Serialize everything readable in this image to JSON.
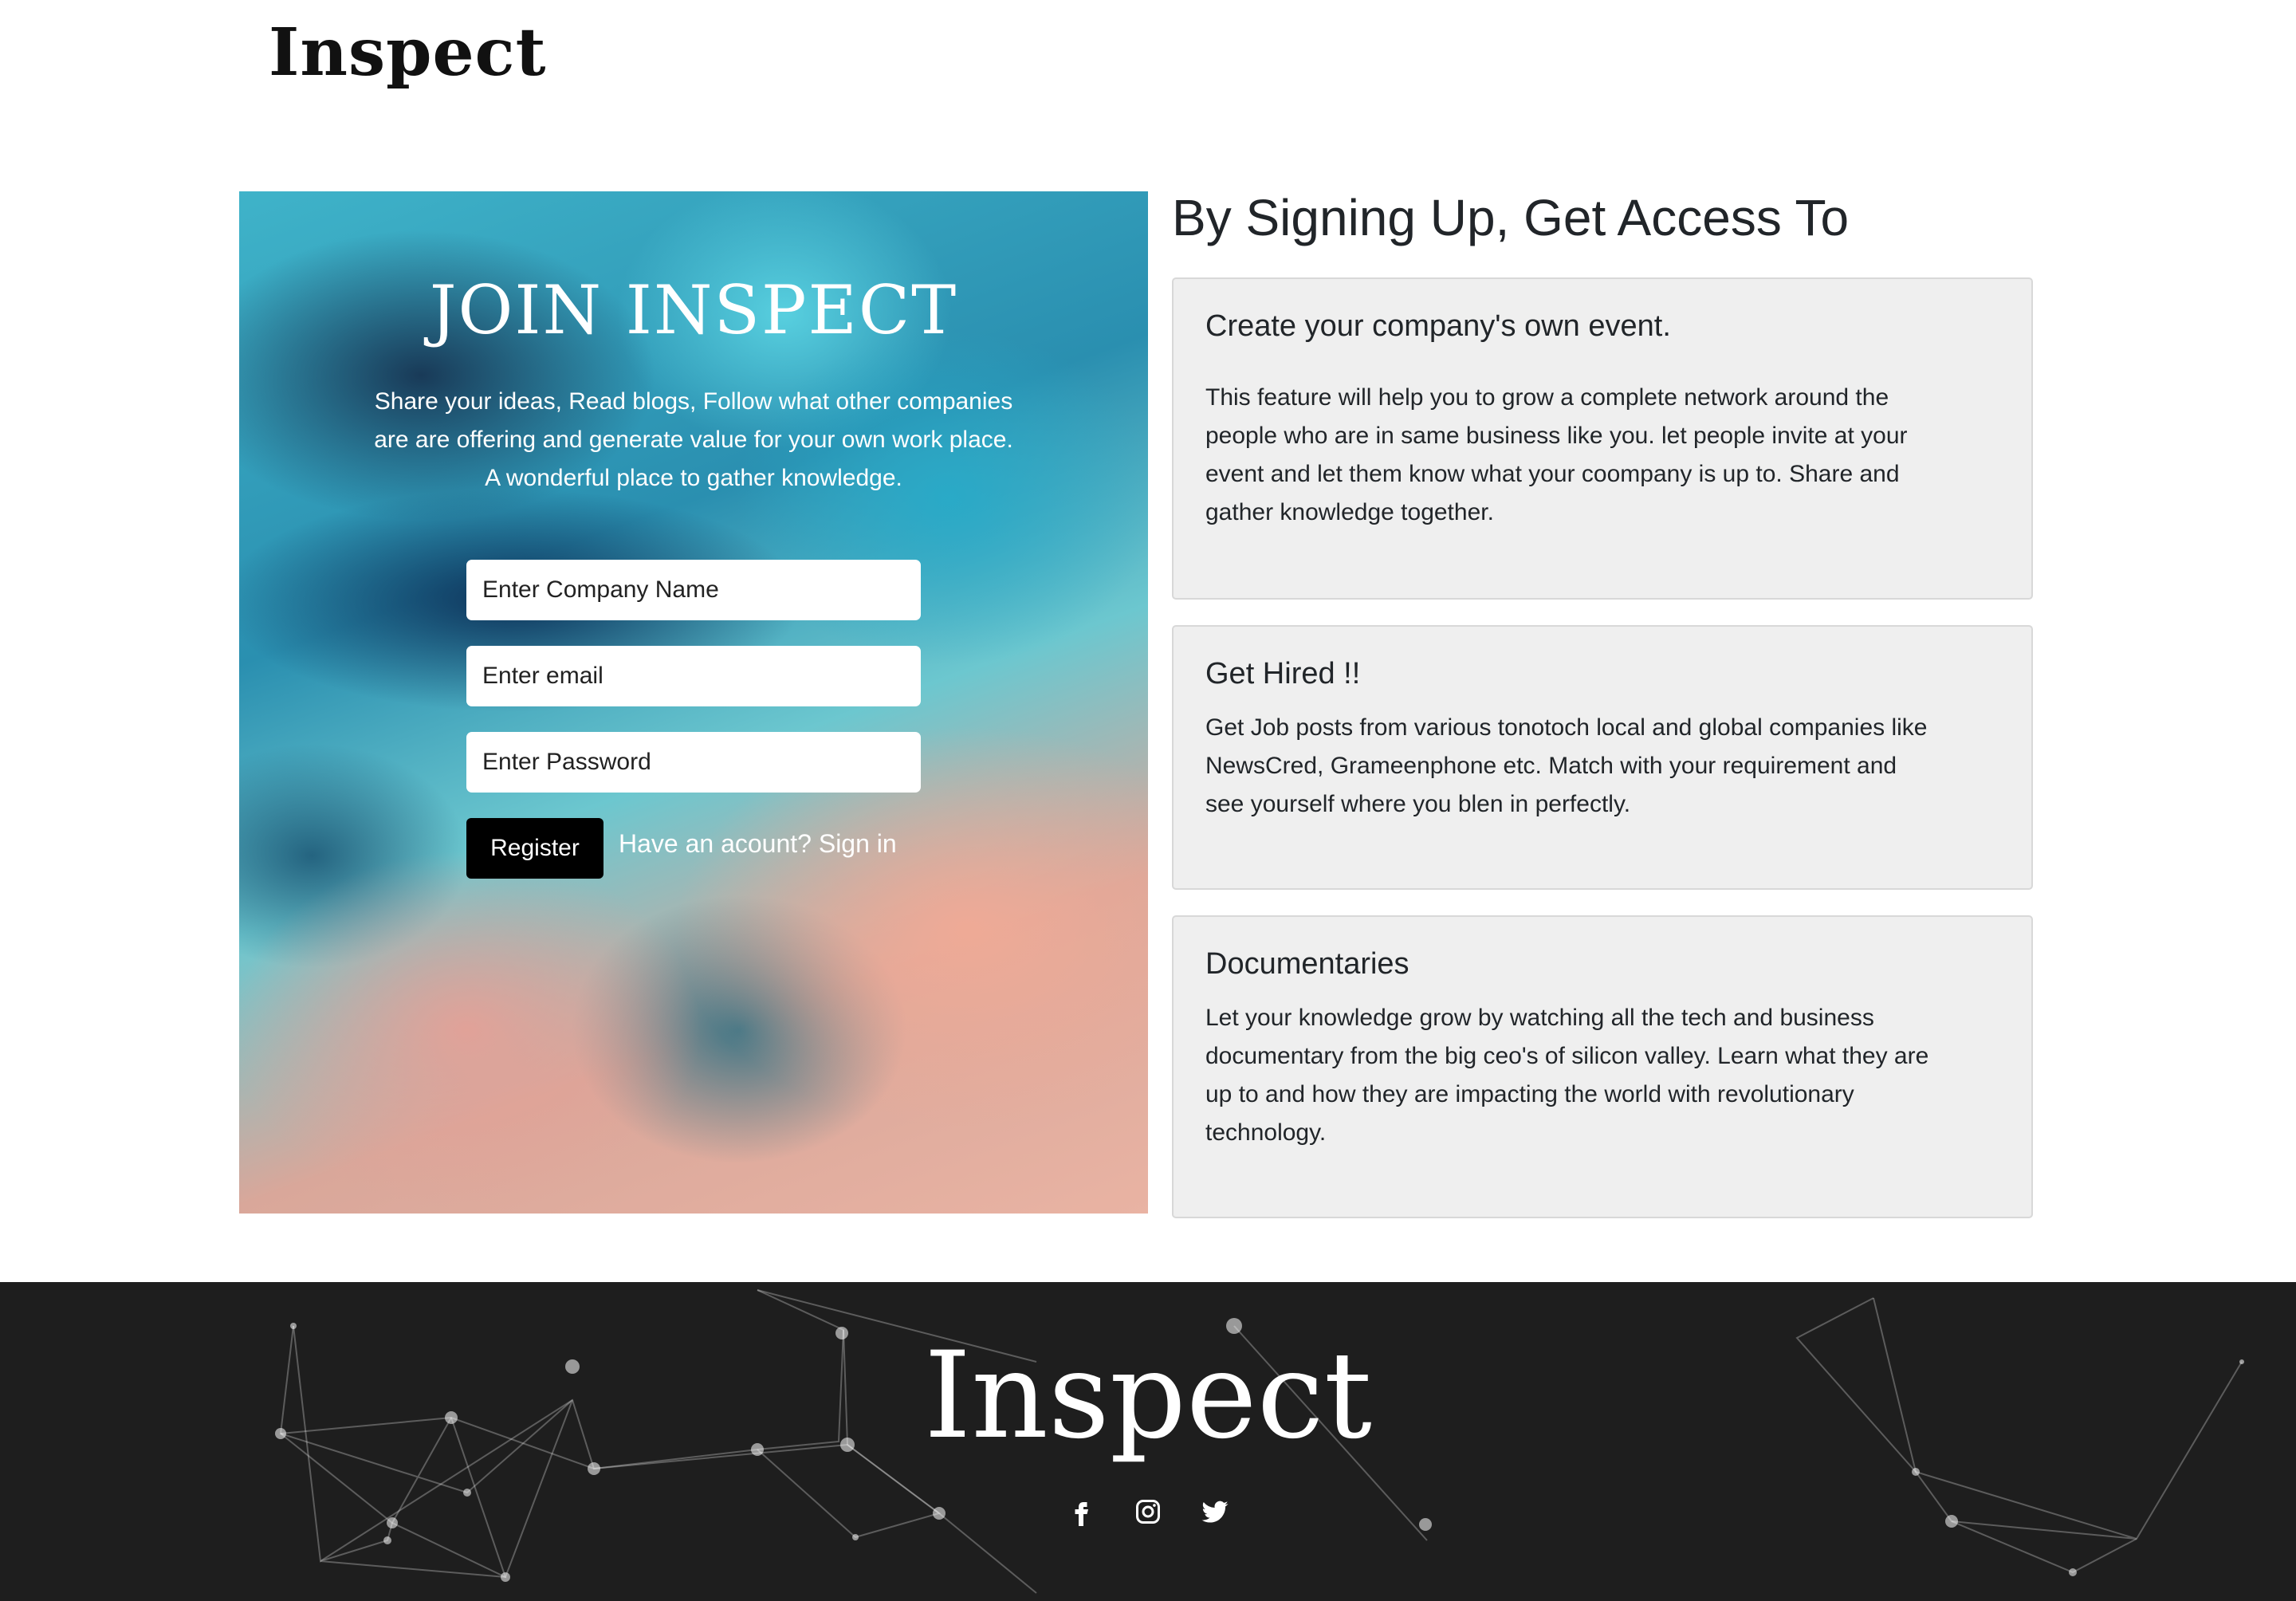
{
  "header": {
    "logo": "Inspect"
  },
  "signup": {
    "title": "JOIN INSPECT",
    "description_lines": [
      "Share your ideas, Read blogs, Follow what other companies",
      "are are offering and generate value for your own work place.",
      "A wonderful place to gather knowledge."
    ],
    "company_placeholder": "Enter Company Name",
    "email_placeholder": "Enter email",
    "password_placeholder": "Enter Password",
    "register_label": "Register",
    "signin_text": "Have an acount? Sign in"
  },
  "access": {
    "title": "By Signing Up, Get Access To",
    "cards": [
      {
        "title": "Create your company's own event.",
        "lines": [
          "This feature will help you to grow a complete network around the",
          "people who are in same business like you. let people invite at your",
          "event and let them know what your coompany is up to. Share and",
          "gather knowledge together."
        ]
      },
      {
        "title": "Get Hired !!",
        "lines": [
          "Get Job posts from various tonotoch local and global companies like",
          "NewsCred, Grameenphone etc. Match with your requirement and",
          "see yourself where you blen in perfectly."
        ]
      },
      {
        "title": "Documentaries",
        "lines": [
          "Let your knowledge grow by watching all the tech and business",
          "documentary from the big ceo's of silicon valley. Learn what they are",
          "up to and how they are impacting the world with revolutionary",
          "technology."
        ]
      }
    ]
  },
  "footer": {
    "logo": "Inspect",
    "social_icons": [
      "facebook-icon",
      "instagram-icon",
      "twitter-icon"
    ],
    "background_color": "#1e1e1e"
  }
}
